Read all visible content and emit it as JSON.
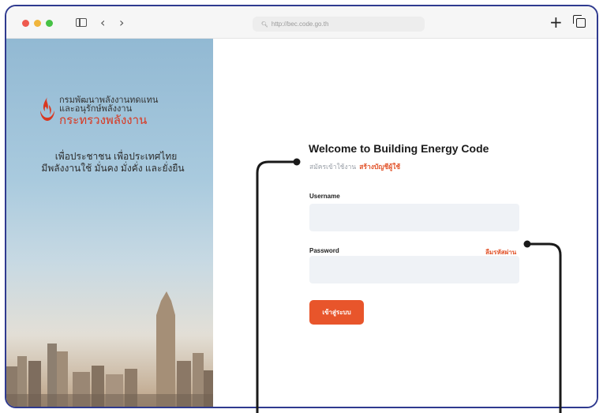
{
  "browser": {
    "url": "http://bec.code.go.th",
    "controls": [
      "close",
      "minimize",
      "zoom"
    ]
  },
  "branding": {
    "org_line1": "กรมพัฒนาพลังงานทดแทน",
    "org_line2": "และอนุรักษ์พลังงาน",
    "ministry": "กระทรวงพลังงาน",
    "slogan_line1": "เพื่อประชาชน เพื่อประเทศไทย",
    "slogan_line2": "มีพลังงานใช้ มั่นคง มั่งคั่ง และยั่งยืน"
  },
  "login": {
    "title": "Welcome to Building Energy Code",
    "signup_prompt": "สมัครเข้าใช้งาน",
    "signup_link": "สร้างบัญชีผู้ใช้",
    "username_label": "Username",
    "password_label": "Password",
    "forgot_link": "ลืมรหัสผ่าน",
    "username_value": "",
    "password_value": "",
    "submit_label": "เข้าสู่ระบบ"
  },
  "colors": {
    "accent": "#e8552b",
    "frame": "#2f3a8f",
    "callout": "#1a1a1a"
  },
  "icons": [
    "sidebar-toggle-icon",
    "back-icon",
    "forward-icon",
    "search-icon",
    "plus-icon",
    "tabs-icon"
  ]
}
